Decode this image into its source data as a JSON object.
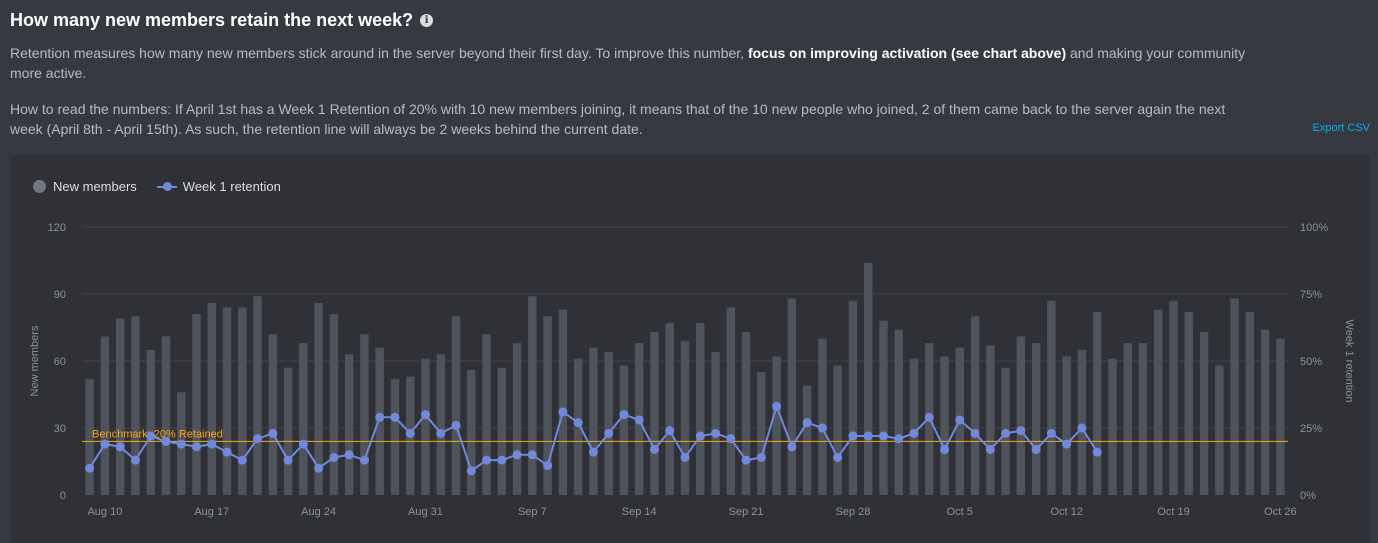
{
  "header": {
    "title": "How many new members retain the next week?",
    "info_icon": "info-icon"
  },
  "description": {
    "p1_start": "Retention measures how many new members stick around in the server beyond their first day. To improve this number, ",
    "p1_bold": "focus on improving activation (see chart above)",
    "p1_end": " and making your community more active.",
    "p2": "How to read the numbers: If April 1st has a Week 1 Retention of 20% with 10 new members joining, it means that of the 10 new people who joined, 2 of them came back to the server again the next week (April 8th - April 15th). As such, the retention line will always be 2 weeks behind the current date."
  },
  "export_label": "Export CSV",
  "legend": {
    "new_members": "New members",
    "week1_retention": "Week 1 retention"
  },
  "colors": {
    "bars": "#4f545c",
    "line": "#7289da",
    "benchmark": "#faa61a",
    "grid": "#40444b",
    "axis_text": "#8e9297"
  },
  "chart_data": {
    "type": "bar",
    "xlabel": "",
    "ylabel": "New members",
    "y2label": "Week 1 retention",
    "ylim": [
      0,
      120
    ],
    "y2lim": [
      0,
      100
    ],
    "y_ticks": [
      "0",
      "30",
      "60",
      "90",
      "120"
    ],
    "y2_ticks": [
      "0%",
      "25%",
      "50%",
      "75%",
      "100%"
    ],
    "x_tick_labels": [
      "Aug 10",
      "Aug 17",
      "Aug 24",
      "Aug 31",
      "Sep 7",
      "Sep 14",
      "Sep 21",
      "Sep 28",
      "Oct 5",
      "Oct 12",
      "Oct 19",
      "Oct 26"
    ],
    "x_tick_indices": [
      1,
      8,
      15,
      22,
      29,
      36,
      43,
      50,
      57,
      64,
      71,
      78
    ],
    "benchmark": {
      "label": "Benchmark: 20% Retained",
      "value": 20
    },
    "grid": true,
    "legend_position": "top-left",
    "series": [
      {
        "name": "New members",
        "type": "bar",
        "values": [
          52,
          71,
          79,
          80,
          65,
          71,
          46,
          81,
          86,
          84,
          84,
          89,
          72,
          57,
          68,
          86,
          81,
          63,
          72,
          66,
          52,
          53,
          61,
          63,
          80,
          56,
          72,
          57,
          68,
          89,
          80,
          83,
          61,
          66,
          64,
          58,
          68,
          73,
          77,
          69,
          77,
          64,
          84,
          73,
          55,
          62,
          88,
          49,
          70,
          58,
          87,
          104,
          78,
          74,
          61,
          68,
          62,
          66,
          80,
          67,
          57,
          71,
          68,
          87,
          62,
          65,
          82,
          61,
          68,
          68,
          83,
          87,
          82,
          73,
          58,
          88,
          82,
          74,
          70
        ]
      },
      {
        "name": "Week 1 retention",
        "type": "line",
        "values": [
          10,
          19,
          18,
          13,
          22,
          20,
          19,
          18,
          19,
          16,
          13,
          21,
          23,
          13,
          19,
          10,
          14,
          15,
          13,
          29,
          29,
          23,
          30,
          23,
          26,
          9,
          13,
          13,
          15,
          15,
          11,
          31,
          27,
          16,
          23,
          30,
          28,
          17,
          24,
          14,
          22,
          23,
          21,
          13,
          14,
          33,
          18,
          27,
          25,
          14,
          22,
          22,
          22,
          21,
          23,
          29,
          17,
          28,
          23,
          17,
          23,
          24,
          17,
          23,
          19,
          25,
          16
        ]
      }
    ]
  }
}
